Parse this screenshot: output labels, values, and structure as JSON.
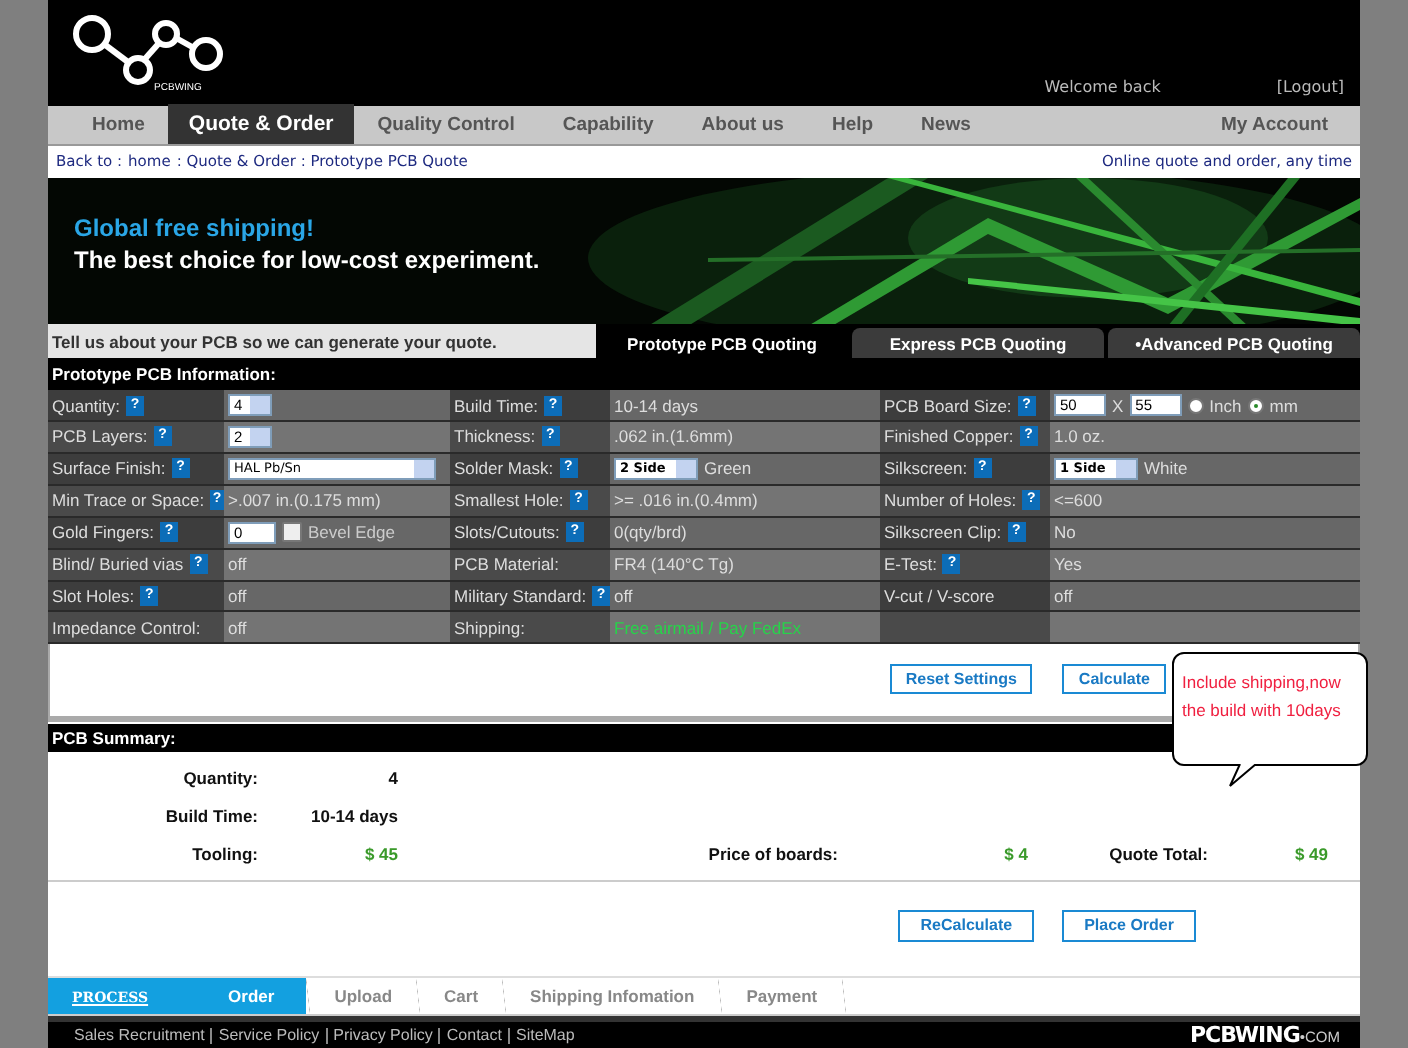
{
  "header": {
    "logo_text": "PCBWING",
    "welcome": "Welcome back",
    "logout": "[Logout]"
  },
  "nav": {
    "items": [
      {
        "label": "Home",
        "selected": false
      },
      {
        "label": "Quote & Order",
        "selected": true
      },
      {
        "label": "Quality Control",
        "selected": false
      },
      {
        "label": "Capability",
        "selected": false
      },
      {
        "label": "About us",
        "selected": false
      },
      {
        "label": "Help",
        "selected": false
      },
      {
        "label": "News",
        "selected": false
      }
    ],
    "account": "My Account"
  },
  "breadcrumb": {
    "prefix": "Back to :",
    "home": "home",
    "rest": ": Quote & Order : Prototype PCB Quote",
    "tagline": "Online quote and order, any time"
  },
  "banner": {
    "kind": "picture",
    "headline": "Global free shipping!",
    "subline": "The best choice for low-cost experiment."
  },
  "intro": "Tell us about your PCB so we can generate your quote.",
  "tabs": [
    {
      "label": "Prototype PCB Quoting",
      "selected": true
    },
    {
      "label": "Express PCB Quoting",
      "selected": false
    },
    {
      "label": "•Advanced PCB Quoting",
      "selected": false
    }
  ],
  "info": {
    "title": "Prototype PCB Information:",
    "rows": [
      [
        {
          "label": "Quantity:",
          "help": "?",
          "controls": [
            {
              "kind": "select",
              "value": "4"
            }
          ]
        },
        {
          "label": "Build Time:",
          "help": "?",
          "controls": [
            {
              "kind": "text",
              "value": "10-14 days"
            }
          ]
        },
        {
          "label": "PCB Board Size:",
          "help": "?",
          "controls": [
            {
              "kind": "input",
              "value": "50"
            },
            {
              "kind": "text",
              "value": "X"
            },
            {
              "kind": "input",
              "value": "55"
            },
            {
              "kind": "radio",
              "label": "Inch",
              "selected": false
            },
            {
              "kind": "radio",
              "label": "mm",
              "selected": true
            }
          ]
        }
      ],
      [
        {
          "label": "PCB Layers:",
          "help": "?",
          "controls": [
            {
              "kind": "select",
              "value": "2"
            }
          ]
        },
        {
          "label": "Thickness:",
          "help": "?",
          "controls": [
            {
              "kind": "text",
              "value": ".062 in.(1.6mm)"
            }
          ]
        },
        {
          "label": "Finished Copper:",
          "help": "?",
          "controls": [
            {
              "kind": "text",
              "value": "1.0 oz."
            }
          ]
        }
      ],
      [
        {
          "label": "Surface Finish:",
          "help": "?",
          "controls": [
            {
              "kind": "wide-select",
              "value": "HAL Pb/Sn"
            }
          ]
        },
        {
          "label": "Solder Mask:",
          "help": "?",
          "controls": [
            {
              "kind": "select",
              "value": "2 Side"
            },
            {
              "kind": "text",
              "value": "Green"
            }
          ]
        },
        {
          "label": "Silkscreen:",
          "help": "?",
          "controls": [
            {
              "kind": "select",
              "value": "1 Side"
            },
            {
              "kind": "text",
              "value": "White"
            }
          ]
        }
      ],
      [
        {
          "label": "Min Trace or Space:",
          "help": "?",
          "controls": [
            {
              "kind": "text",
              "value": ">.007 in.(0.175 mm)"
            }
          ]
        },
        {
          "label": "Smallest Hole:",
          "help": "?",
          "controls": [
            {
              "kind": "text",
              "value": ">= .016 in.(0.4mm)"
            }
          ]
        },
        {
          "label": "Number of Holes:",
          "help": "?",
          "controls": [
            {
              "kind": "text",
              "value": "<=600"
            }
          ]
        }
      ],
      [
        {
          "label": "Gold Fingers:",
          "help": "?",
          "controls": [
            {
              "kind": "input",
              "value": "0"
            },
            {
              "kind": "checkbox",
              "label": "Bevel Edge",
              "checked": false
            }
          ]
        },
        {
          "label": "Slots/Cutouts:",
          "help": "?",
          "controls": [
            {
              "kind": "text",
              "value": "0(qty/brd)"
            }
          ]
        },
        {
          "label": "Silkscreen Clip:",
          "help": "?",
          "controls": [
            {
              "kind": "text",
              "value": "No"
            }
          ]
        }
      ],
      [
        {
          "label": "Blind/ Buried vias",
          "help": "?",
          "controls": [
            {
              "kind": "text",
              "value": "off"
            }
          ]
        },
        {
          "label": "PCB Material:",
          "controls": [
            {
              "kind": "text",
              "value": "FR4 (140°C Tg)"
            }
          ]
        },
        {
          "label": "E-Test:",
          "help": "?",
          "controls": [
            {
              "kind": "text",
              "value": "Yes"
            }
          ]
        }
      ],
      [
        {
          "label": "Slot Holes:",
          "help": "?",
          "controls": [
            {
              "kind": "text",
              "value": "off"
            }
          ]
        },
        {
          "label": "Military Standard:",
          "help": "?",
          "controls": [
            {
              "kind": "text",
              "value": "off"
            }
          ]
        },
        {
          "label": "V-cut / V-score",
          "controls": [
            {
              "kind": "text",
              "value": "off"
            }
          ]
        }
      ],
      [
        {
          "label": "Impedance Control:",
          "controls": [
            {
              "kind": "text",
              "value": "off"
            }
          ]
        },
        {
          "label": "Shipping:",
          "controls": [
            {
              "kind": "highlight",
              "value": "Free airmail / Pay FedEx"
            }
          ]
        }
      ]
    ]
  },
  "form_buttons": [
    "Reset Settings",
    "Calculate"
  ],
  "callout": "Include shipping,now the build with 10days",
  "summary": {
    "title": "PCB Summary:",
    "quantity": {
      "label": "Quantity:",
      "value": "4"
    },
    "build_time": {
      "label": "Build Time:",
      "value": "10-14 days"
    },
    "tooling": {
      "label": "Tooling:",
      "value": "$ 45"
    },
    "price": {
      "label": "Price of boards:",
      "value": "$ 4"
    },
    "total": {
      "label": "Quote Total:",
      "value": "$ 49"
    }
  },
  "summary_buttons": [
    "ReCalculate",
    "Place Order"
  ],
  "process": {
    "title": "PROCESS",
    "steps": [
      {
        "label": "Order",
        "selected": true
      },
      {
        "label": "Upload",
        "selected": false
      },
      {
        "label": "Cart",
        "selected": false
      },
      {
        "label": "Shipping Infomation",
        "selected": false
      },
      {
        "label": "Payment",
        "selected": false
      }
    ]
  },
  "footer": {
    "links": [
      "Sales Recruitment",
      "Service Policy",
      "Privacy Policy",
      "Contact",
      "SiteMap"
    ],
    "brand": "PCBWING",
    "brand_suffix": "•COM"
  }
}
